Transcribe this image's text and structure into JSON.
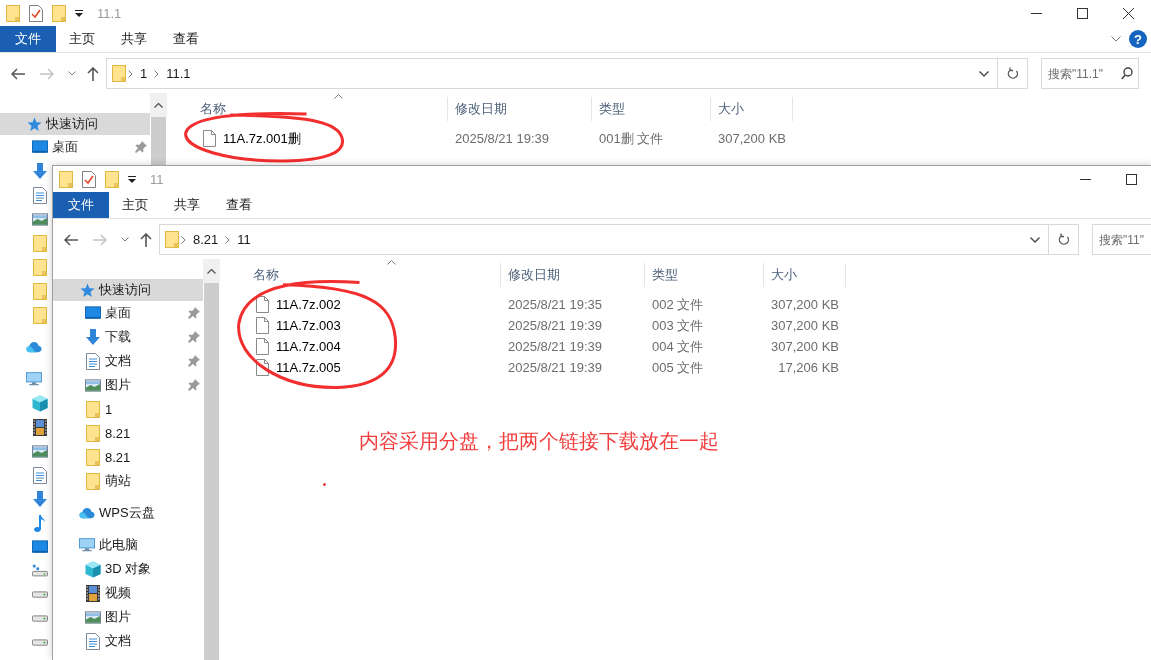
{
  "windows": [
    {
      "title": "11.1",
      "controls": [
        {
          "kind": "minimize"
        },
        {
          "kind": "maximize"
        },
        {
          "kind": "close"
        }
      ],
      "ribbon_tabs": [
        {
          "label": "文件",
          "selected": true
        },
        {
          "label": "主页",
          "selected": false
        },
        {
          "label": "共享",
          "selected": false
        },
        {
          "label": "查看",
          "selected": false
        }
      ],
      "help": "?",
      "nav": {
        "back_disabled": false,
        "forward_disabled": true
      },
      "crumbs": [
        "1",
        "11.1"
      ],
      "search": {
        "placeholder": "搜索\"11.1\"",
        "icon": true
      },
      "sidebar": [
        {
          "kind": "star",
          "label": "快速访问",
          "selected": true,
          "pinned": false,
          "children": [
            {
              "kind": "desktop",
              "label": "桌面",
              "selected": false,
              "pinned": true
            },
            {
              "kind": "download"
            },
            {
              "kind": "document"
            },
            {
              "kind": "picture"
            },
            {
              "kind": "folder"
            },
            {
              "kind": "folder"
            },
            {
              "kind": "folder"
            },
            {
              "kind": "folder"
            }
          ]
        },
        {
          "kind": "cloud"
        },
        {
          "kind": "pc",
          "children": [
            {
              "kind": "cube"
            },
            {
              "kind": "video"
            },
            {
              "kind": "picture"
            },
            {
              "kind": "document"
            },
            {
              "kind": "download"
            },
            {
              "kind": "music"
            },
            {
              "kind": "desktop"
            },
            {
              "kind": "network-drive"
            },
            {
              "kind": "drive"
            },
            {
              "kind": "drive"
            },
            {
              "kind": "drive"
            }
          ]
        }
      ],
      "columns": [
        "名称",
        "修改日期",
        "类型",
        "大小"
      ],
      "files": [
        {
          "name": "11A.7z.001删",
          "date": "2025/8/21 19:39",
          "type": "001删 文件",
          "size": "307,200 KB"
        }
      ],
      "files_circled": true
    },
    {
      "title": "11",
      "controls": [
        {
          "kind": "minimize"
        },
        {
          "kind": "maximize"
        }
      ],
      "ribbon_tabs": [
        {
          "label": "文件",
          "selected": true
        },
        {
          "label": "主页",
          "selected": false
        },
        {
          "label": "共享",
          "selected": false
        },
        {
          "label": "查看",
          "selected": false
        }
      ],
      "nav": {
        "back_disabled": false,
        "forward_disabled": true
      },
      "crumbs": [
        "8.21",
        "11"
      ],
      "search": {
        "placeholder": "搜索\"11\""
      },
      "sidebar": [
        {
          "kind": "star",
          "label": "快速访问",
          "selected": true,
          "pinned": false,
          "children": [
            {
              "kind": "desktop",
              "label": "桌面",
              "selected": false,
              "pinned": true
            },
            {
              "kind": "download",
              "label": "下载",
              "selected": false,
              "pinned": true
            },
            {
              "kind": "document",
              "label": "文档",
              "selected": false,
              "pinned": true
            },
            {
              "kind": "picture",
              "label": "图片",
              "selected": false,
              "pinned": true
            },
            {
              "kind": "folder",
              "label": "1",
              "selected": false,
              "pinned": false
            },
            {
              "kind": "folder",
              "label": "8.21",
              "selected": false,
              "pinned": false
            },
            {
              "kind": "folder",
              "label": "8.21",
              "selected": false,
              "pinned": false
            },
            {
              "kind": "folder",
              "label": "萌站",
              "selected": false,
              "pinned": false
            }
          ]
        },
        {
          "kind": "cloud",
          "label": "WPS云盘",
          "selected": false,
          "pinned": false
        },
        {
          "kind": "pc",
          "label": "此电脑",
          "selected": false,
          "pinned": false,
          "children": [
            {
              "kind": "cube",
              "label": "3D 对象",
              "selected": false,
              "pinned": false
            },
            {
              "kind": "video",
              "label": "视频",
              "selected": false,
              "pinned": false
            },
            {
              "kind": "picture",
              "label": "图片",
              "selected": false,
              "pinned": false
            },
            {
              "kind": "document",
              "label": "文档",
              "selected": false,
              "pinned": false
            }
          ]
        }
      ],
      "columns": [
        "名称",
        "修改日期",
        "类型",
        "大小"
      ],
      "files": [
        {
          "name": "11A.7z.002",
          "date": "2025/8/21 19:35",
          "type": "002 文件",
          "size": "307,200 KB"
        },
        {
          "name": "11A.7z.003",
          "date": "2025/8/21 19:39",
          "type": "003 文件",
          "size": "307,200 KB"
        },
        {
          "name": "11A.7z.004",
          "date": "2025/8/21 19:39",
          "type": "004 文件",
          "size": "307,200 KB"
        },
        {
          "name": "11A.7z.005",
          "date": "2025/8/21 19:39",
          "type": "005 文件",
          "size": "17,206 KB"
        }
      ],
      "files_circled": true,
      "note": "内容采用分盘，把两个链接下载放在一起",
      "stray_dot": true
    }
  ]
}
